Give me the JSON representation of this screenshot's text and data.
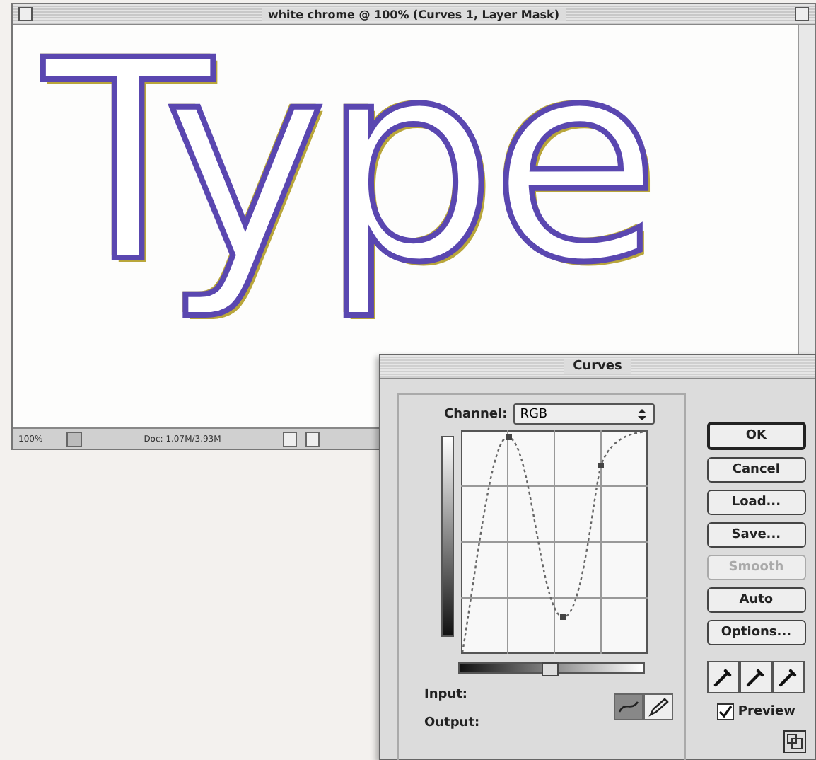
{
  "document_window": {
    "title": "white chrome @ 100% (Curves 1, Layer Mask)",
    "canvas_text": "Type",
    "status_bar": {
      "zoom": "100%",
      "doc_info": "Doc: 1.07M/3.93M"
    }
  },
  "curves_dialog": {
    "title": "Curves",
    "channel": {
      "label": "Channel:",
      "value": "RGB"
    },
    "buttons": [
      {
        "label": "OK",
        "default": true,
        "disabled": false
      },
      {
        "label": "Cancel",
        "default": false,
        "disabled": false
      },
      {
        "label": "Load...",
        "default": false,
        "disabled": false
      },
      {
        "label": "Save...",
        "default": false,
        "disabled": false
      },
      {
        "label": "Smooth",
        "default": false,
        "disabled": true
      },
      {
        "label": "Auto",
        "default": false,
        "disabled": false
      },
      {
        "label": "Options...",
        "default": false,
        "disabled": false
      }
    ],
    "input_label": "Input:",
    "output_label": "Output:",
    "curve_tools": [
      {
        "kind": "curve",
        "selected": true
      },
      {
        "kind": "pencil",
        "selected": false
      }
    ],
    "preview": {
      "label": "Preview",
      "checked": true
    }
  }
}
